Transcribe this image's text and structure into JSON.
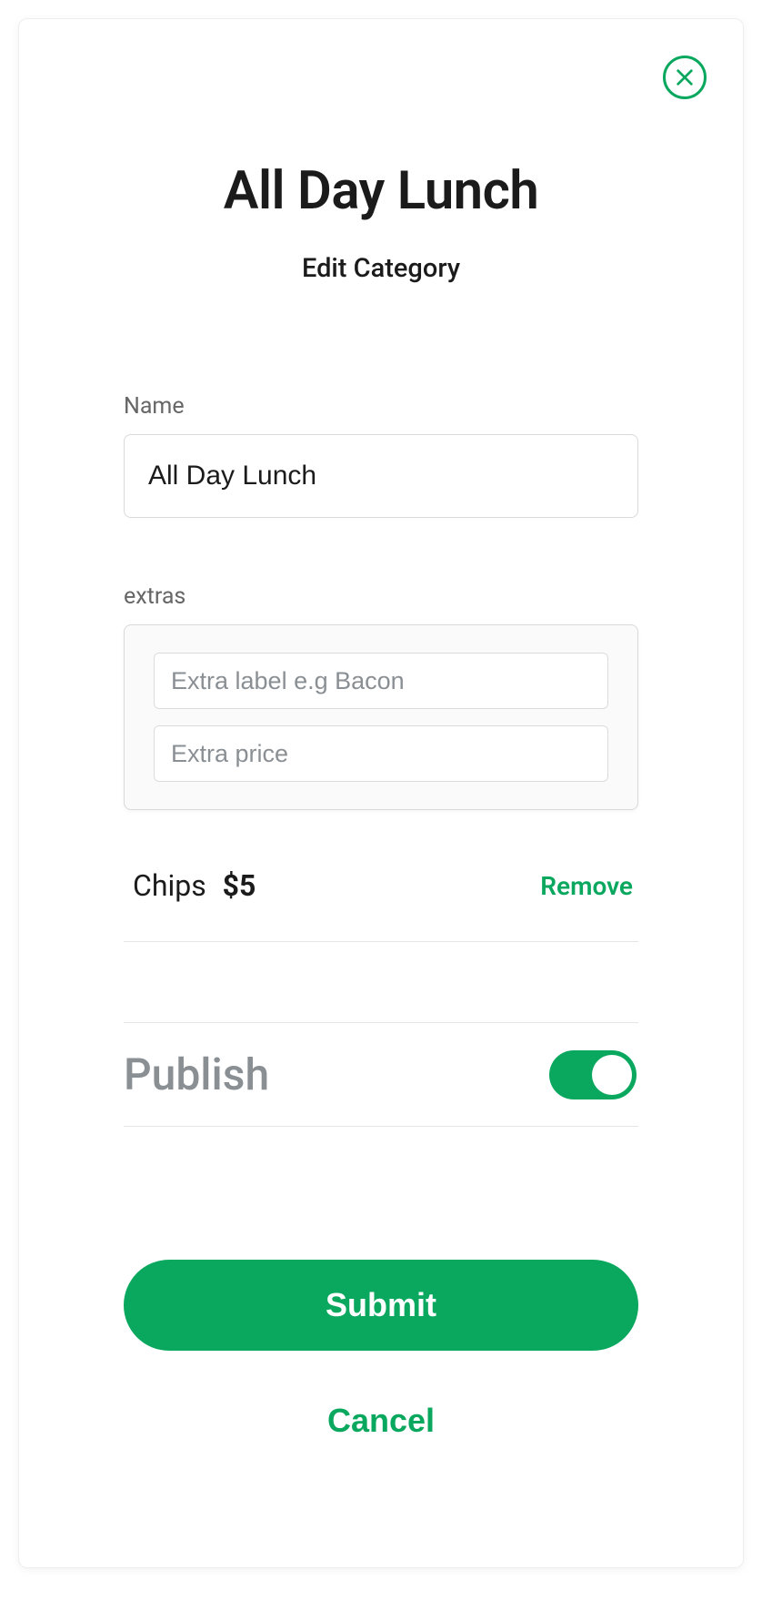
{
  "modal": {
    "title": "All Day Lunch",
    "subtitle": "Edit Category"
  },
  "fields": {
    "name_label": "Name",
    "name_value": "All Day Lunch",
    "extras_label": "extras",
    "extra_label_placeholder": "Extra label e.g Bacon",
    "extra_price_placeholder": "Extra price"
  },
  "extras_list": [
    {
      "name": "Chips",
      "price": "$5"
    }
  ],
  "actions": {
    "remove": "Remove",
    "publish_label": "Publish",
    "publish_on": true,
    "submit": "Submit",
    "cancel": "Cancel"
  },
  "colors": {
    "accent": "#0aa85e"
  }
}
